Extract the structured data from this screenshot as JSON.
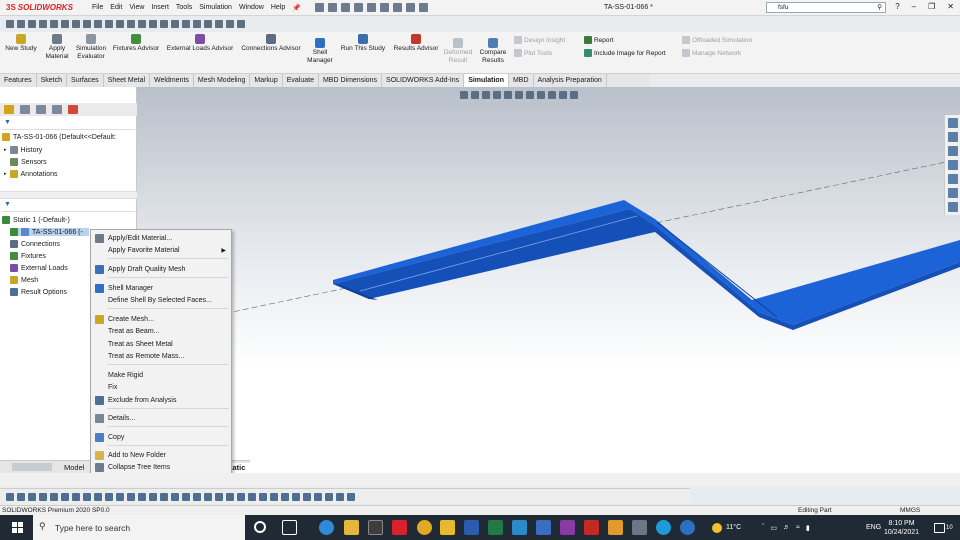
{
  "app": {
    "logo_text": "SOLIDWORKS",
    "document_title": "TA-SS-01-066 *",
    "search_placeholder": "fsfu"
  },
  "menu": [
    "File",
    "Edit",
    "View",
    "Insert",
    "Tools",
    "Simulation",
    "Window",
    "Help"
  ],
  "command_manager": {
    "new_study": "New Study",
    "apply_material": "Apply Material",
    "simulation_evaluator": "Simulation Evaluator",
    "fixtures_advisor": "Fixtures Advisor",
    "external_loads_advisor": "External Loads Advisor",
    "connections_advisor": "Connections Advisor",
    "shell_manager": "Shell Manager",
    "run_this_study": "Run This Study",
    "results_advisor": "Results Advisor",
    "deformed_result": "Deformed Result",
    "compare_results": "Compare Results",
    "design_insight": "Design Insight",
    "plot_tools": "Plot Tools",
    "report": "Report",
    "include_image": "Include Image for Report",
    "offloaded_simulation": "Offloaded Simulation",
    "manage_network": "Manage Network"
  },
  "tabs": [
    "Features",
    "Sketch",
    "Surfaces",
    "Sheet Metal",
    "Weldments",
    "Mesh Modeling",
    "Markup",
    "Evaluate",
    "MBD Dimensions",
    "SOLIDWORKS Add-Ins",
    "Simulation",
    "MBD",
    "Analysis Preparation"
  ],
  "active_tab": "Simulation",
  "feature_tree": {
    "part_root": "TA-SS-01-066  (Default<<Default:",
    "items": [
      "History",
      "Sensors",
      "Annotations"
    ],
    "study": "Static 1 (-Default-)",
    "part": "TA-SS-01-066 (-",
    "study_items": [
      "Connections",
      "Fixtures",
      "External Loads",
      "Mesh",
      "Result Options"
    ]
  },
  "context_menu": [
    {
      "label": "Apply/Edit Material...",
      "icon": "material-icon"
    },
    {
      "label": "Apply Favorite Material",
      "icon": "",
      "submenu": true
    },
    {
      "label": "Apply Draft Quality Mesh",
      "icon": "draft-mesh-icon"
    },
    {
      "label": "Shell Manager",
      "icon": "shell-icon"
    },
    {
      "label": "Define Shell By Selected Faces...",
      "icon": ""
    },
    {
      "label": "Create Mesh...",
      "icon": "mesh-icon"
    },
    {
      "label": "Treat as Beam...",
      "icon": ""
    },
    {
      "label": "Treat as Sheet Metal",
      "icon": ""
    },
    {
      "label": "Treat as Remote Mass...",
      "icon": ""
    },
    {
      "label": "Make Rigid",
      "icon": ""
    },
    {
      "label": "Fix",
      "icon": ""
    },
    {
      "label": "Exclude from Analysis",
      "icon": "exclude-icon"
    },
    {
      "label": "Details...",
      "icon": "details-icon"
    },
    {
      "label": "Copy",
      "icon": "copy-icon"
    },
    {
      "label": "Add to New Folder",
      "icon": "folder-icon"
    },
    {
      "label": "Collapse Tree Items",
      "icon": "collapse-icon"
    }
  ],
  "bottom_tabs": {
    "model": "Model",
    "study": "Static 1"
  },
  "status": {
    "left": "SOLIDWORKS Premium 2020 SP0.0",
    "editing": "Editing Part",
    "units": "MMGS"
  },
  "taskbar": {
    "search_placeholder": "Type here to search",
    "weather": "11°C",
    "lang": "ENG",
    "time": "8:10 PM",
    "date": "10/24/2021",
    "notifications": "10"
  },
  "colors": {
    "part_blue": "#1c63d8",
    "sw_red": "#d92526",
    "taskbar": "#1f2a35"
  }
}
